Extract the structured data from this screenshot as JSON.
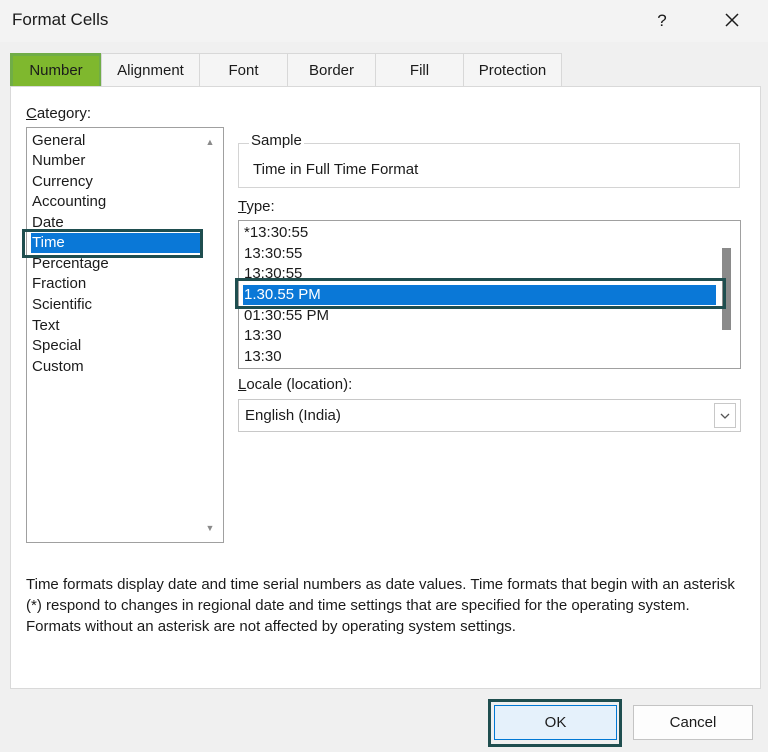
{
  "window": {
    "title": "Format Cells",
    "help": "?",
    "close": "✕"
  },
  "tabs": [
    {
      "label": "Number",
      "active": true
    },
    {
      "label": "Alignment"
    },
    {
      "label": "Font"
    },
    {
      "label": "Border"
    },
    {
      "label": "Fill"
    },
    {
      "label": "Protection"
    }
  ],
  "category": {
    "label_hotkey": "C",
    "label_rest": "ategory:",
    "items": [
      "General",
      "Number",
      "Currency",
      "Accounting",
      "Date",
      "Time",
      "Percentage",
      "Fraction",
      "Scientific",
      "Text",
      "Special",
      "Custom"
    ],
    "selected": "Time"
  },
  "sample": {
    "label": "Sample",
    "value": "Time in Full Time Format"
  },
  "type": {
    "label_hotkey": "T",
    "label_rest": "ype:",
    "items": [
      "*13:30:55",
      "13:30:55",
      "13:30:55",
      "1.30.55 PM",
      "01:30:55 PM",
      "13:30",
      "13:30"
    ],
    "selected": "1.30.55 PM"
  },
  "locale": {
    "label_hotkey": "L",
    "label_rest": "ocale (location):",
    "value": "English (India)"
  },
  "description": "Time formats display date and time serial numbers as date values.  Time formats that begin with an asterisk (*) respond to changes in regional date and time settings that are specified for the operating system. Formats without an asterisk are not affected by operating system settings.",
  "buttons": {
    "ok": "OK",
    "cancel": "Cancel"
  },
  "colors": {
    "accent_tab": "#7fb82e",
    "selection": "#0a78d7",
    "highlight_outline": "#1f4e4f"
  }
}
